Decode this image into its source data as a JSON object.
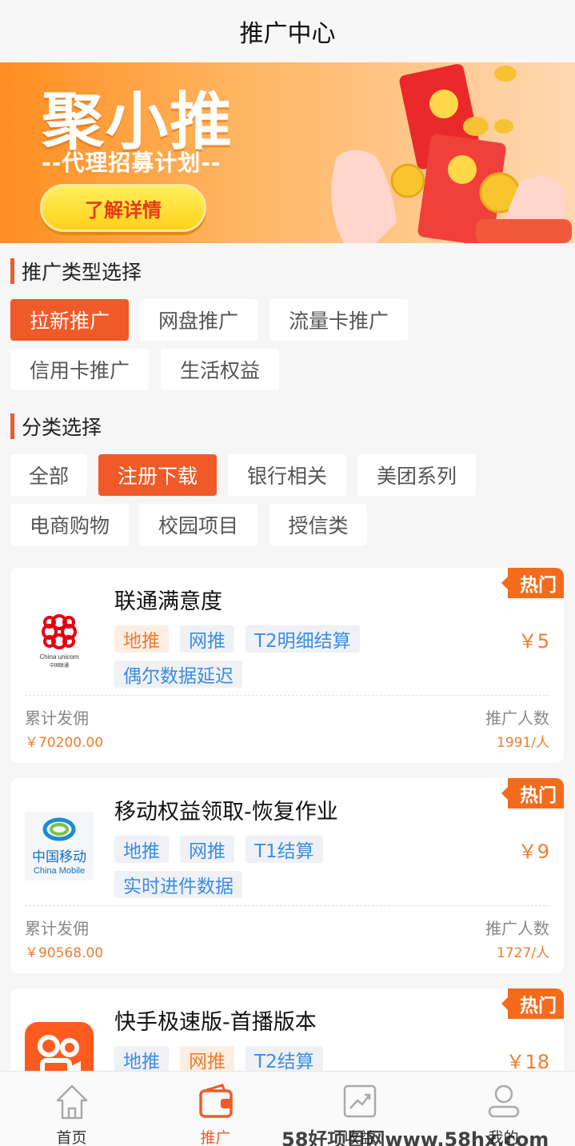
{
  "header": {
    "title": "推广中心"
  },
  "banner": {
    "title": "聚小推",
    "subtitle": "--代理招募计划--",
    "button": "了解详情"
  },
  "promo_types": {
    "title": "推广类型选择",
    "items": [
      "拉新推广",
      "网盘推广",
      "流量卡推广",
      "信用卡推广",
      "生活权益"
    ],
    "selected": "拉新推广"
  },
  "categories": {
    "title": "分类选择",
    "items": [
      "全部",
      "注册下载",
      "银行相关",
      "美团系列",
      "电商购物",
      "校园项目",
      "授信类"
    ],
    "selected": "注册下载"
  },
  "cards": [
    {
      "badge": "热门",
      "title": "联通满意度",
      "tags": [
        "地推",
        "网推",
        "T2明细结算",
        "偶尔数据延迟"
      ],
      "price": "￥5",
      "commission_label": "累计发佣",
      "commission_value": "￥70200.00",
      "people_label": "推广人数",
      "people_value": "1991/人",
      "logo": "china-unicom-logo",
      "logo_text": "China unicom",
      "logo_sub": "中国联通"
    },
    {
      "badge": "热门",
      "title": "移动权益领取-恢复作业",
      "tags": [
        "地推",
        "网推",
        "T1结算",
        "实时进件数据"
      ],
      "price": "￥9",
      "commission_label": "累计发佣",
      "commission_value": "￥90568.00",
      "people_label": "推广人数",
      "people_value": "1727/人",
      "logo": "china-mobile-logo",
      "logo_text": "中国移动",
      "logo_sub": "China Mobile"
    },
    {
      "badge": "热门",
      "title": "快手极速版-首播版本",
      "tags": [
        "地推",
        "网推",
        "T2结算"
      ],
      "price": "￥18",
      "logo": "kuaishou-logo"
    }
  ],
  "tabbar": {
    "items": [
      {
        "label": "首页",
        "icon": "home-icon"
      },
      {
        "label": "推广",
        "icon": "wallet-icon"
      },
      {
        "label": "收益",
        "icon": "chart-icon"
      },
      {
        "label": "我的",
        "icon": "user-icon"
      }
    ],
    "active": "推广"
  },
  "watermark": "58好项目网www.58hx.com",
  "colors": {
    "accent": "#f05a28",
    "price": "#ef7d2e",
    "tag_blue": "#3a8ee6"
  }
}
